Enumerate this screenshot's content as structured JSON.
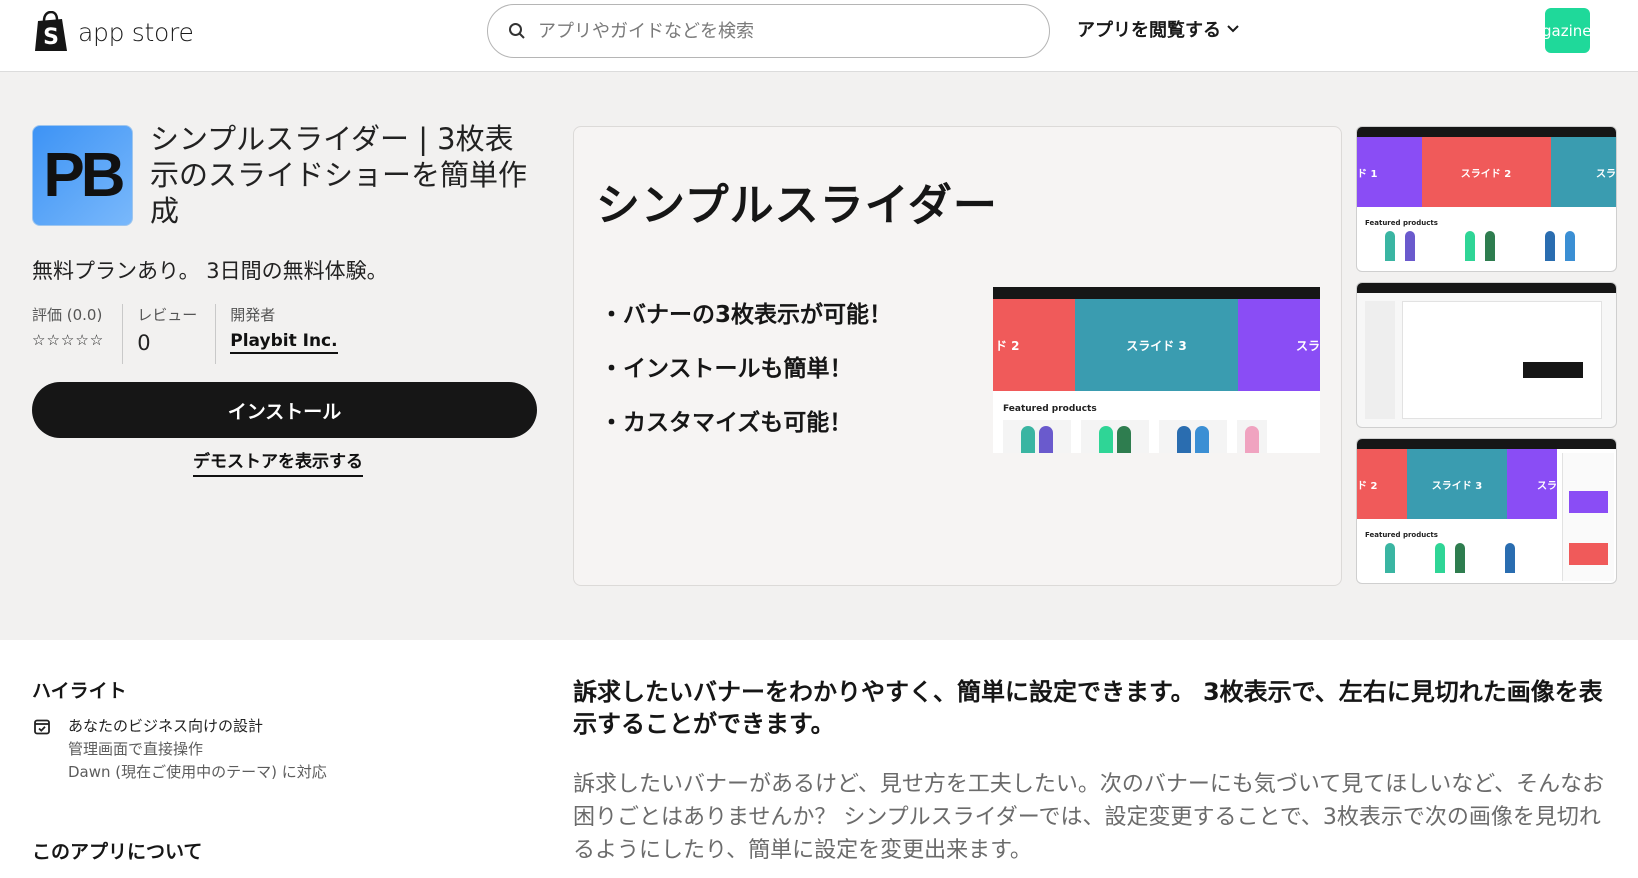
{
  "header": {
    "logo_text": "app store",
    "search_placeholder": "アプリやガイドなどを検索",
    "browse_label": "アプリを閲覧する",
    "avatar_text": "gazineデ",
    "avatar_color": "#1fd99a"
  },
  "app": {
    "icon_text": "PB",
    "title": "シンプルスライダー | 3枚表示のスライドショーを簡単作成",
    "pricing": "無料プランあり。 3日間の無料体験。",
    "rating_label": "評価 (0.0)",
    "rating_stars": "☆☆☆☆☆",
    "reviews_label": "レビュー",
    "reviews_count": "0",
    "developer_label": "開発者",
    "developer_name": "Playbit Inc.",
    "install_label": "インストール",
    "demo_label": "デモストアを表示する"
  },
  "screenshot_main": {
    "title": "シンプルスライダー",
    "bullets": [
      "・バナーの3枚表示が可能！",
      "・インストールも簡単！",
      "・カスタマイズも可能！"
    ],
    "slides": [
      "ド 2",
      "スライド 3",
      "スラ"
    ],
    "featured": "Featured products"
  },
  "thumbnails": {
    "thumb1_slides": [
      "ド 1",
      "スライド 2",
      "スラ"
    ],
    "thumb3_slides": [
      "ド 2",
      "スライド 3",
      "スラ"
    ],
    "featured": "Featured products"
  },
  "highlights": {
    "heading": "ハイライト",
    "item_title": "あなたのビジネス向けの設計",
    "item_lines": [
      "管理画面で直接操作",
      "Dawn (現在ご使用中のテーマ) に対応"
    ]
  },
  "about": {
    "heading": "このアプリについて"
  },
  "description": {
    "headline": "訴求したいバナーをわかりやすく、簡単に設定できます。 3枚表示で、左右に見切れた画像を表示することができます。",
    "body": "訴求したいバナーがあるけど、見せ方を工夫したい。次のバナーにも気づいて見てほしいなど、そんなお困りごとはありませんか？ シンプルスライダーでは、設定変更することで、3枚表示で次の画像を見切れるようにしたり、簡単に設定を変更出来ます。"
  },
  "colors": {
    "accent_dark": "#161616",
    "hero_bg": "#f2f1f0",
    "slide_red": "#f05a5a",
    "slide_teal": "#3a9cb0",
    "slide_purple": "#8a4df5"
  }
}
